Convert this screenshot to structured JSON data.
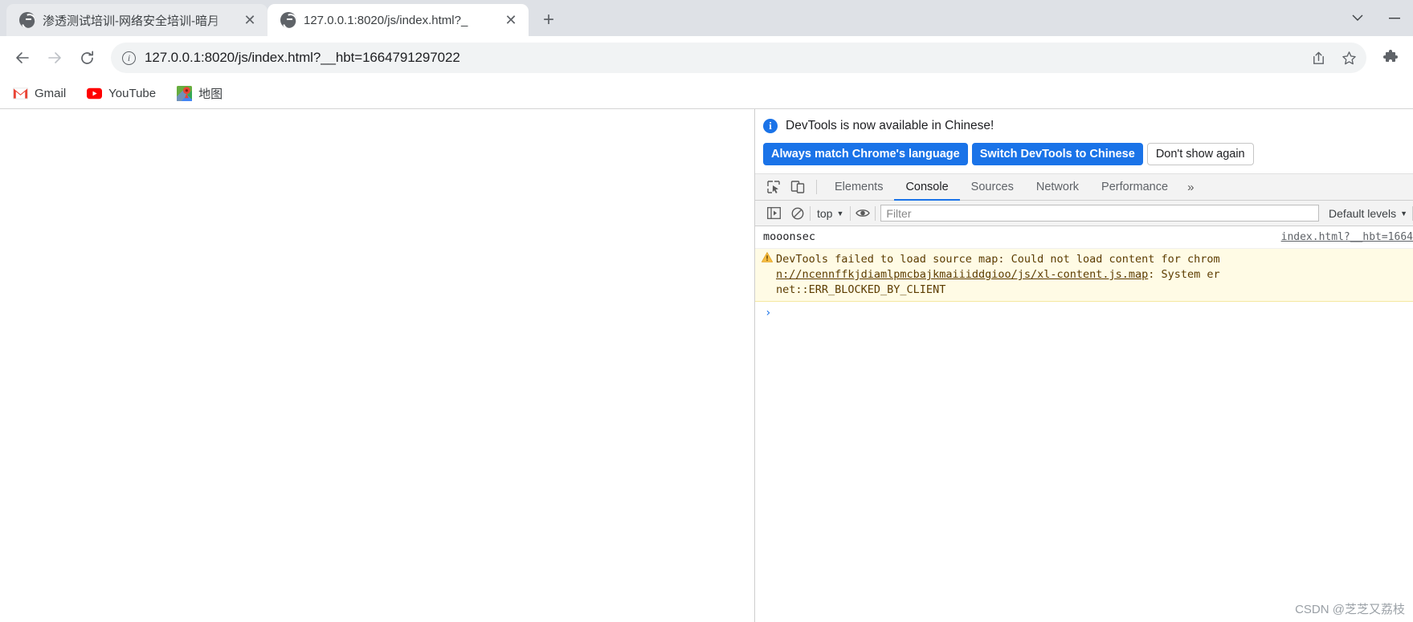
{
  "window": {
    "controls": [
      "chevron-down",
      "minimize"
    ]
  },
  "tabs": [
    {
      "title": "渗透测试培训-网络安全培训-暗月",
      "favicon": "globe-icon",
      "active": false
    },
    {
      "title": "127.0.0.1:8020/js/index.html?_",
      "favicon": "globe-icon",
      "active": true
    }
  ],
  "newtab_label": "+",
  "toolbar": {
    "back_label": "←",
    "forward_label": "→",
    "reload_label": "⟳",
    "security_icon": "info-icon",
    "url_text": "127.0.0.1:8020/js/index.html?__hbt=1664791297022",
    "url_host": "127.0.0.1:8020",
    "url_path": "/js/index.html?__hbt=1664791297022",
    "share_icon": "share-icon",
    "bookmark_icon": "star-icon",
    "extensions_icon": "puzzle-icon"
  },
  "bookmarks": [
    {
      "label": "Gmail",
      "icon": "gmail-icon"
    },
    {
      "label": "YouTube",
      "icon": "youtube-icon"
    },
    {
      "label": "地图",
      "icon": "maps-icon"
    }
  ],
  "devtools": {
    "banner": {
      "icon": "info-circle-icon",
      "message": "DevTools is now available in Chinese!",
      "buttons": [
        {
          "label": "Always match Chrome's language",
          "style": "primary"
        },
        {
          "label": "Switch DevTools to Chinese",
          "style": "primary"
        },
        {
          "label": "Don't show again",
          "style": "secondary"
        }
      ]
    },
    "tools": {
      "inspect_icon": "inspect-element-icon",
      "device_icon": "device-toolbar-icon"
    },
    "tabs": [
      {
        "label": "Elements",
        "active": false
      },
      {
        "label": "Console",
        "active": true
      },
      {
        "label": "Sources",
        "active": false
      },
      {
        "label": "Network",
        "active": false
      },
      {
        "label": "Performance",
        "active": false
      }
    ],
    "more_label": "»",
    "console_toolbar": {
      "sidebar_icon": "console-sidebar-icon",
      "clear_icon": "clear-console-icon",
      "context_label": "top",
      "context_caret": "▼",
      "eye_icon": "live-expression-icon",
      "filter_placeholder": "Filter",
      "levels_label": "Default levels",
      "levels_caret": "▼"
    },
    "console_messages": [
      {
        "type": "log",
        "text": "mooonsec",
        "source": "index.html?__hbt=1664"
      },
      {
        "type": "warning",
        "icon": "warning-triangle-icon",
        "line1": "DevTools failed to load source map: Could not load content for chrom",
        "link": "n://ncennffkjdiamlpmcbajkmaiiiddgioo/js/xl-content.js.map",
        "line2_tail": ": System er",
        "line3": "net::ERR_BLOCKED_BY_CLIENT"
      }
    ],
    "prompt_symbol": "›"
  },
  "colors": {
    "accent": "#1a73e8",
    "tabstrip_bg": "#dee1e6",
    "warning_bg": "#fffbe5",
    "warning_icon": "#e5a30a"
  },
  "watermark": "CSDN @芝芝又荔枝"
}
